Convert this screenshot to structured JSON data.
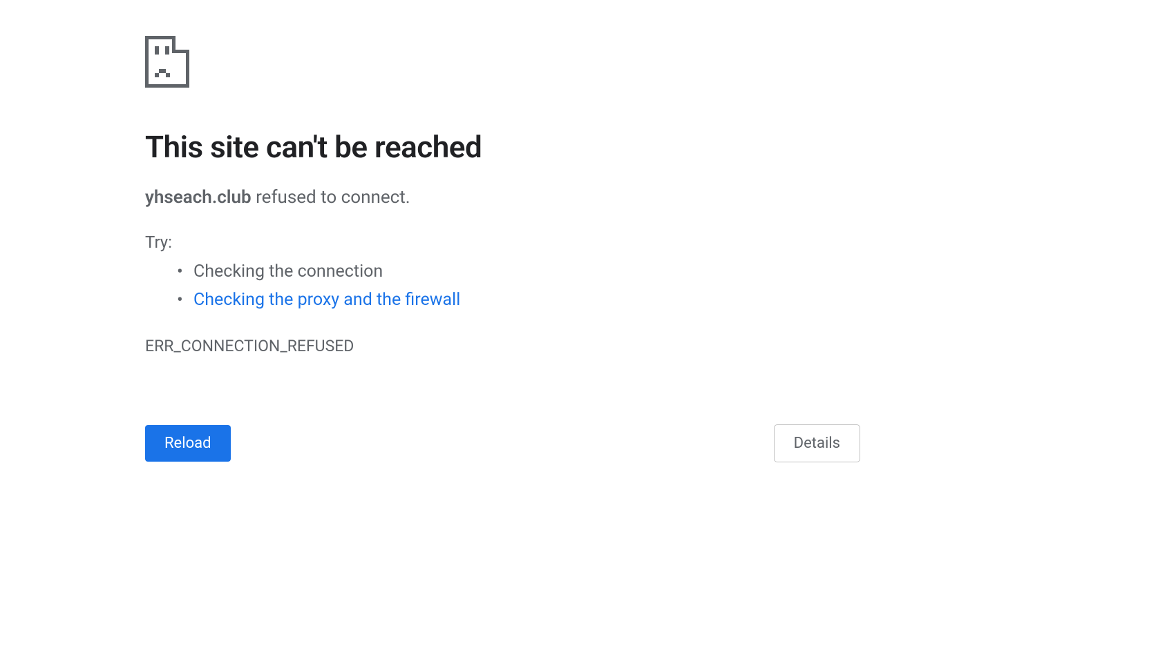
{
  "error": {
    "title": "This site can't be reached",
    "domain": "yhseach.club",
    "message_suffix": " refused to connect.",
    "try_label": "Try:",
    "suggestions": [
      {
        "text": "Checking the connection",
        "is_link": false
      },
      {
        "text": "Checking the proxy and the firewall",
        "is_link": true
      }
    ],
    "error_code": "ERR_CONNECTION_REFUSED"
  },
  "buttons": {
    "reload": "Reload",
    "details": "Details"
  }
}
